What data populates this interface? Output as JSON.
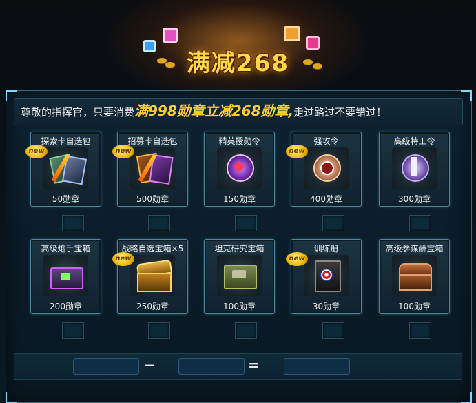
{
  "banner": {
    "title": "满减268"
  },
  "notice": {
    "prefix": "尊敬的指挥官，只要消费",
    "highlight": "满998勋章立减268勋章,",
    "suffix": "走过路过不要错过！"
  },
  "badge_text": "new",
  "items": [
    {
      "name": "探索卡自选包",
      "price": "50勋章",
      "new": true,
      "icon": "card-pack-icon"
    },
    {
      "name": "招募卡自选包",
      "price": "500勋章",
      "new": true,
      "icon": "card-pack-icon"
    },
    {
      "name": "精英授勋令",
      "price": "150勋章",
      "new": false,
      "icon": "elite-medal-icon"
    },
    {
      "name": "强攻令",
      "price": "400勋章",
      "new": true,
      "icon": "assault-medal-icon"
    },
    {
      "name": "高级特工令",
      "price": "300勋章",
      "new": false,
      "icon": "agent-medal-icon"
    },
    {
      "name": "高级炮手宝箱",
      "price": "200勋章",
      "new": false,
      "icon": "gunner-chest-icon"
    },
    {
      "name": "战略自选宝箱×5",
      "price": "250勋章",
      "new": true,
      "icon": "treasure-chest-icon"
    },
    {
      "name": "坦克研究宝箱",
      "price": "100勋章",
      "new": false,
      "icon": "tank-chest-icon"
    },
    {
      "name": "训练册",
      "price": "30勋章",
      "new": true,
      "icon": "training-book-icon"
    },
    {
      "name": "高级参谋酬宝箱",
      "price": "100勋章",
      "new": false,
      "icon": "wooden-chest-icon"
    }
  ],
  "calc": {
    "minus": "−",
    "equals": "="
  },
  "colors": {
    "accent": "#ffcc33",
    "panel_border": "#4f8aa0",
    "slot": "#0d2a3a"
  }
}
